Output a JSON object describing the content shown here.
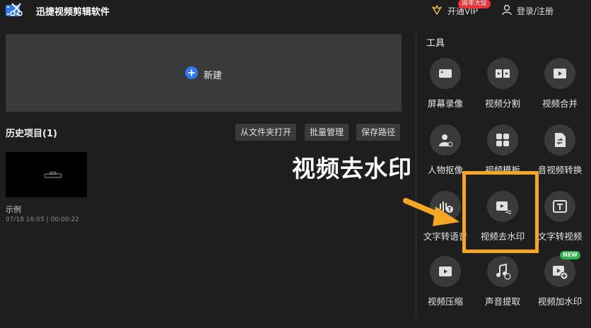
{
  "app": {
    "title": "迅捷视频剪辑软件",
    "vip_label": "开通VIP",
    "promo_badge": "周年大促",
    "login_label": "登录/注册"
  },
  "main": {
    "new_project_label": "新建",
    "history_title": "历史项目(1)",
    "buttons": {
      "open_folder": "从文件夹打开",
      "batch_manage": "批量管理",
      "save_path": "保存路径"
    },
    "projects": [
      {
        "name": "示例",
        "meta": "07/18 16:05 | 00:00:22"
      }
    ]
  },
  "tools": {
    "title": "工具",
    "items": [
      {
        "label": "屏幕录像",
        "icon": "screen-record-icon"
      },
      {
        "label": "视频分割",
        "icon": "video-split-icon"
      },
      {
        "label": "视频合并",
        "icon": "video-merge-icon"
      },
      {
        "label": "人物抠像",
        "icon": "person-cutout-icon"
      },
      {
        "label": "视频模板",
        "icon": "video-template-icon"
      },
      {
        "label": "音视频转换",
        "icon": "av-convert-icon"
      },
      {
        "label": "文字转语音",
        "icon": "text-to-speech-icon"
      },
      {
        "label": "视频去水印",
        "icon": "remove-watermark-icon"
      },
      {
        "label": "文字转视频",
        "icon": "text-to-video-icon"
      },
      {
        "label": "视频压缩",
        "icon": "video-compress-icon"
      },
      {
        "label": "声音提取",
        "icon": "audio-extract-icon"
      },
      {
        "label": "视频加水印",
        "icon": "add-watermark-icon"
      }
    ],
    "new_badge": "NEW"
  },
  "annotation": {
    "text": "视频去水印",
    "color": "#f5a623"
  }
}
